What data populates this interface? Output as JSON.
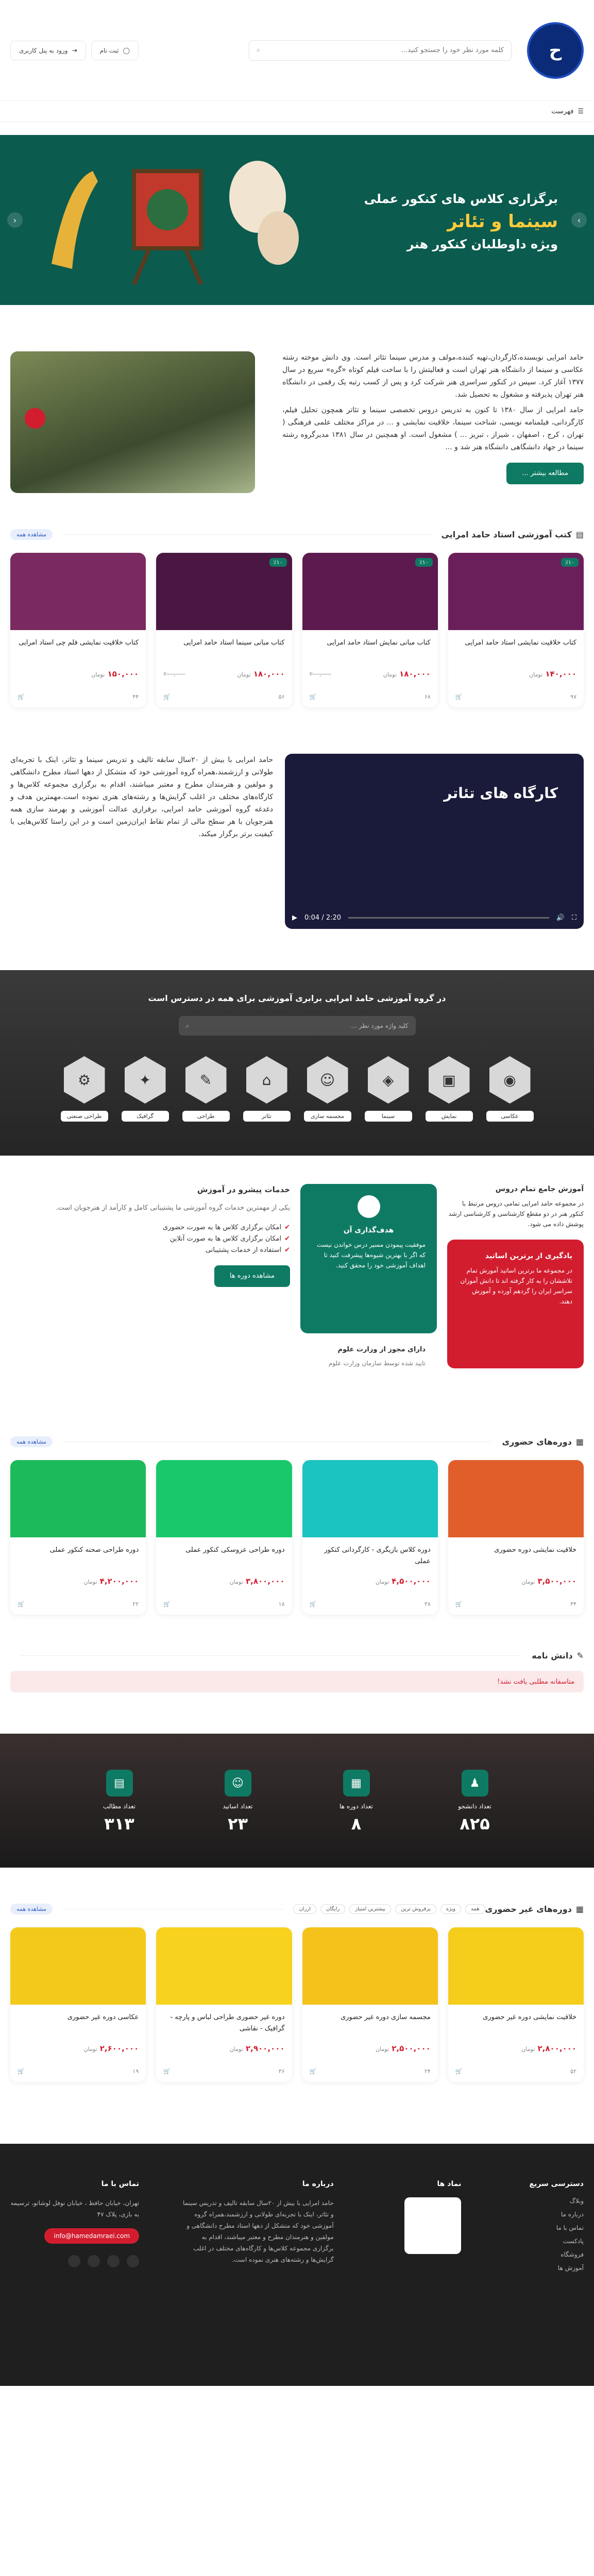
{
  "header": {
    "search_placeholder": "کلمه مورد نظر خود را جستجو کنید...",
    "login_label": "ثبت نام",
    "library_label": "ورود به پنل کاربری",
    "menu_label": "فهرست"
  },
  "banner": {
    "line1": "برگزاری کلاس های کنکور عملی",
    "line2": "سینما و تئاتر",
    "line3": "ویژه داوطلبان کنکور هنر"
  },
  "about": {
    "paragraphs": [
      "حامد امرایی نویسنده،کارگردان،تهیه کننده،مولف و مدرس سینما تئاتر است. وی دانش موخته رشته عکاسی و سینما از دانشگاه هنر تهران است و فعالیتش را با ساخت فیلم کوتاه «گره» سریع در سال ۱۳۷۷ آغاز کرد. سپس در کنکور سراسری هنر شرکت کرد و پس از کسب رتبه یک رقمی در دانشگاه هنر تهران پذیرفته و مشغول به تحصیل شد.",
      "حامد امرایی از سال ۱۳۸۰ تا کنون به تدریس دروس تخصصی سینما و تئاتر همچون تحلیل فیلم، کارگردانی، فیلمنامه نویسی، شناخت سینما، خلاقیت نمایشی و ... در مراکز مختلف علمی فرهنگی ( تهران ، کرج ، اصفهان ، شیراز ، تبریز ... ) مشغول است. او همچنین در سال ۱۳۸۱ مدیرگروه رشته سینما در جهاد دانشگاهی دانشگاه هنر شد و ..."
    ],
    "button": "مطالعه بیشتر ..."
  },
  "books": {
    "title": "کتب آموزشی استاد حامد امرایی",
    "see_all": "مشاهده همه",
    "items": [
      {
        "title": "کتاب خلاقیت نمایشی استاد حامد امرایی",
        "price": "۱۴۰,۰۰۰",
        "old": "",
        "currency": "تومان",
        "students": "۹۷",
        "tag": "٪۱۰"
      },
      {
        "title": "کتاب مبانی نمایش استاد حامد امرایی",
        "price": "۱۸۰,۰۰۰",
        "old": "۲۰۰,۰۰۰",
        "currency": "تومان",
        "students": "۶۸",
        "tag": "٪۱۰"
      },
      {
        "title": "کتاب مبانی سینما استاد حامد امرایی",
        "price": "۱۸۰,۰۰۰",
        "old": "۲۰۰,۰۰۰",
        "currency": "تومان",
        "students": "۵۶",
        "tag": "٪۱۰"
      },
      {
        "title": "کتاب خلاقیت نمایشی فلم چی استاد امرایی",
        "price": "۱۵۰,۰۰۰",
        "old": "",
        "currency": "تومان",
        "students": "۴۴",
        "tag": ""
      }
    ]
  },
  "video": {
    "text": "حامد امرایی با بیش از ۲۰سال سابقه تالیف و تدریس سینما و تئاتر، اینک با تجربه‌ای طولانی و ارزشمند،همراه گروه آموزشی خود که متشکل از دهها استاد مطرح دانشگاهی و مولفین و هنرمندان مطرح و معتبر میباشند، اقدام به برگزاری مجموعه کلاس‌ها و کارگاه‌های مختلف در اغلب گرایش‌ها و رشته‌های هنری نموده است.مهمترین هدف و دغدغه گروه آموزشی حامد امرایی، برقراری عدالت آموزشی و بهرمند سازی همه هنرجویان با هر سطح مالی از تمام نقاط ایران‌زمین است و در این راستا کلاس‌هایی با کیفیت برتر برگزار میکند.",
    "caption": "کارگاه های تئاتر",
    "time": "0:04 / 2:20"
  },
  "categories": {
    "title": "در گروه آموزشی حامد امرایی برابری آموزشی برای همه در دسترس است",
    "search_placeholder": "کلید واژه مورد نظر ...",
    "items": [
      {
        "label": "عکاسی",
        "icon": "camera-icon"
      },
      {
        "label": "نمایش",
        "icon": "film-icon"
      },
      {
        "label": "سینما",
        "icon": "clapper-icon"
      },
      {
        "label": "مجسمه سازی",
        "icon": "bust-icon"
      },
      {
        "label": "تئاتر",
        "icon": "stage-icon"
      },
      {
        "label": "طراحی",
        "icon": "pencil-icon"
      },
      {
        "label": "گرافیک",
        "icon": "graphic-icon"
      },
      {
        "label": "طراحی صنعتی",
        "icon": "gear-icon"
      }
    ]
  },
  "features": {
    "col1": {
      "title": "آموزش جامع تمام دروس",
      "text": "در مجموعه حامد امرایی تمامی دروس مرتبط با کنکور هنر در دو مقطع کارشناسی و کارشناسی ارشد پوشش داده می شود.",
      "red_title": "یادگیری از برترین اساتید",
      "red_text": "در مجموعه ما برترین اساتید آموزش تمام تلاششان را به کار گرفته اند تا دانش آموزان سراسر ایران را گردهم آورده و آموزش دهند."
    },
    "col2": {
      "green_title": "هدف‌گذاری آن",
      "green_text": "موفقیت پیمودن مسیر درس خواندن نیست که اگر با بهترین شیوه‌ها پیشرفت کنید تا اهداف آموزشی خود را محقق کنید.",
      "cert_title": "دارای مجوز از وزارت علوم",
      "cert_text": "تایید شده توسط سازمان وزارت علوم"
    },
    "col3": {
      "title": "خدمات پیشرو در آموزش",
      "text": "یکی از مهمترین خدمات گروه آموزشی ما پشتیبانی کامل و کارآمد از هنرجویان است.",
      "checks": [
        "امکان برگزاری کلاس ها به صورت حضوری",
        "امکان برگزاری کلاس ها به صورت آنلاین",
        "استفاده از خدمات پشتیبانی"
      ],
      "button": "مشاهده دوره ها"
    }
  },
  "courses": {
    "title": "دوره‌های حضوری",
    "see_all": "مشاهده همه",
    "items": [
      {
        "title": "خلاقیت نمایشی دوره حضوری",
        "price": "۳,۵۰۰,۰۰۰",
        "currency": "تومان",
        "students": "۳۴"
      },
      {
        "title": "دوره کلاس بازیگری - کارگردانی کنکور عملی",
        "price": "۴,۵۰۰,۰۰۰",
        "currency": "تومان",
        "students": "۳۸"
      },
      {
        "title": "دوره طراحی عروسکی کنکور عملی",
        "price": "۳,۸۰۰,۰۰۰",
        "currency": "تومان",
        "students": "۱۸"
      },
      {
        "title": "دوره طراحی صحنه کنکور عملی",
        "price": "۴,۲۰۰,۰۰۰",
        "currency": "تومان",
        "students": "۲۲"
      }
    ]
  },
  "blog": {
    "title": "دانش نامه",
    "empty": "متاسفانه مطلبی یافت نشد!"
  },
  "stats": [
    {
      "label": "تعداد دانشجو",
      "value": "۸۲۵",
      "icon": "student-icon"
    },
    {
      "label": "تعداد دوره ها",
      "value": "۸",
      "icon": "course-icon"
    },
    {
      "label": "تعداد اساتید",
      "value": "۲۳",
      "icon": "teacher-icon"
    },
    {
      "label": "تعداد مطالب",
      "value": "۳۱۳",
      "icon": "article-icon"
    }
  ],
  "online": {
    "title": "دوره‌های غیر حضوری",
    "filters": [
      "همه",
      "ویژه",
      "پرفروش ترین",
      "بیشترین امتیاز",
      "رایگان",
      "ارزان"
    ],
    "see_all": "مشاهده همه",
    "items": [
      {
        "title": "خلاقیت نمایشی دوره غیر حضوری",
        "price": "۲,۸۰۰,۰۰۰",
        "currency": "تومان",
        "students": "۵۲"
      },
      {
        "title": "مجسمه سازی دوره غیر حضوری",
        "price": "۲,۵۰۰,۰۰۰",
        "currency": "تومان",
        "students": "۲۴"
      },
      {
        "title": "دوره غیر حضوری طراحی لباس و پارچه - گرافیک - نقاشی",
        "price": "۲,۹۰۰,۰۰۰",
        "currency": "تومان",
        "students": "۳۶"
      },
      {
        "title": "عکاسی دوره غیر حضوری",
        "price": "۲,۶۰۰,۰۰۰",
        "currency": "تومان",
        "students": "۱۹"
      }
    ]
  },
  "footer": {
    "quick_title": "دسترسی سریع",
    "quick_links": [
      "وبلاگ",
      "درباره ما",
      "تماس با ما",
      "پادکست",
      "فروشگاه",
      "آموزش ها"
    ],
    "trust_title": "نماد ها",
    "about_title": "درباره ما",
    "about_text": "حامد امرایی با بیش از ۲۰سال سابقه تالیف و تدریس سینما و تئاتر، اینک با تجربه‌ای طولانی و ارزشمند،همراه گروه آموزشی خود که متشکل از دهها استاد مطرح دانشگاهی و مولفین و هنرمندان مطرح و معتبر میباشند، اقدام به برگزاری مجموعه کلاس‌ها و کارگاه‌های مختلف در اغلب گرایش‌ها و رشته‌های هنری نموده است.",
    "contact_title": "تماس با ما",
    "address": "تهران، خیابان حافظ ، خیابان نوفل لوشاتو، ترسیمه به بازی، پلاک ۴۷",
    "email": "info@hamedamraei.com"
  }
}
